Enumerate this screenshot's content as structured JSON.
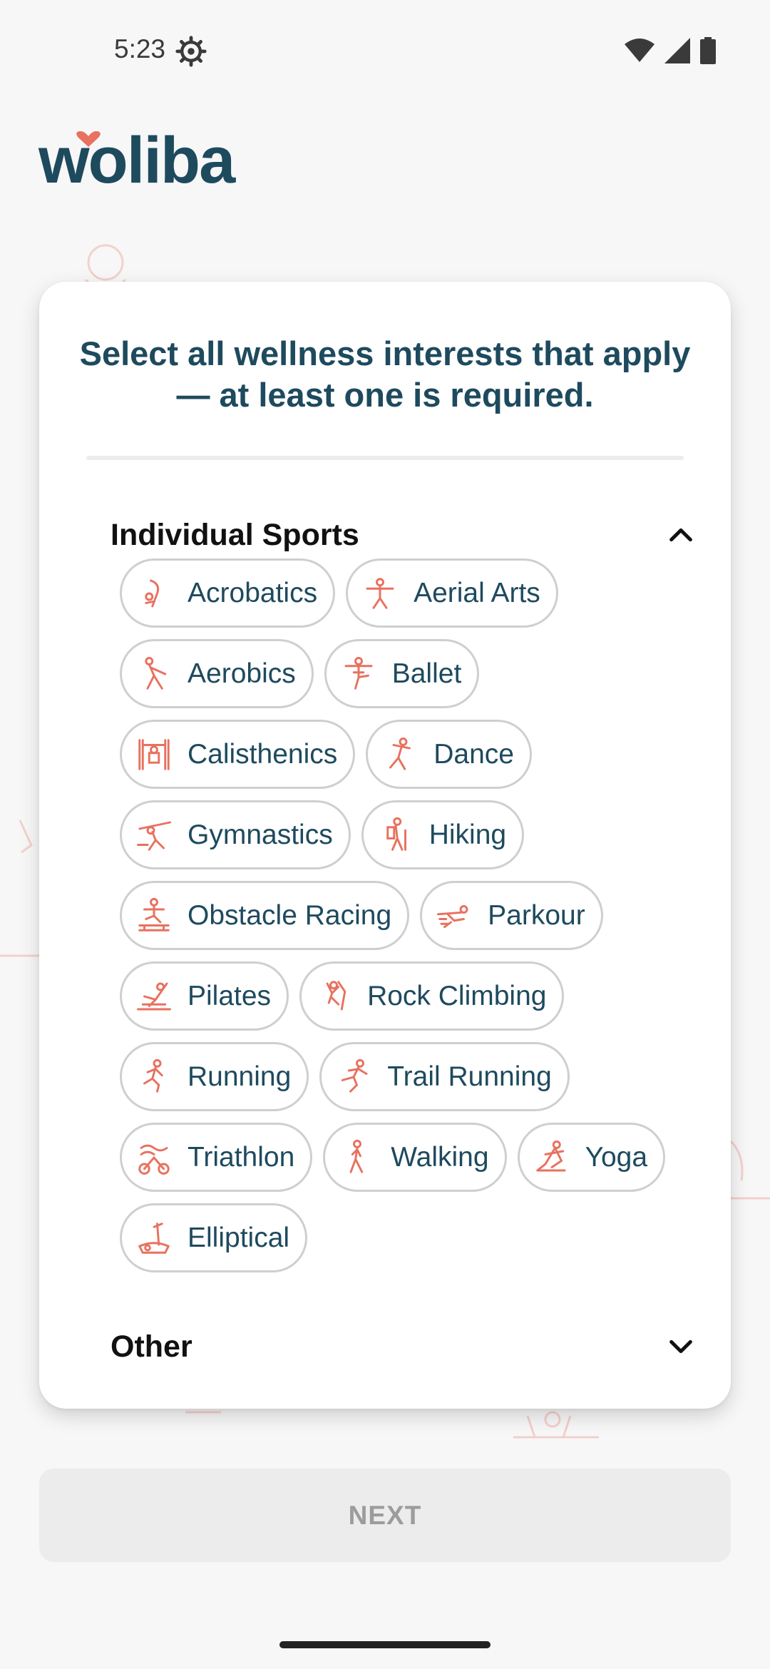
{
  "status_bar": {
    "time": "5:23",
    "icons": [
      "settings-gear-icon",
      "wifi-icon",
      "cellular-signal-icon",
      "battery-icon"
    ]
  },
  "brand": {
    "logo_text": "woliba",
    "color_primary": "#1e4a5e",
    "color_accent": "#e8715f"
  },
  "card": {
    "title": "Select all wellness interests that apply — at least one is required."
  },
  "sections": [
    {
      "title": "Individual Sports",
      "expanded": true,
      "chips": [
        {
          "label": "Acrobatics",
          "icon": "acrobatics-icon"
        },
        {
          "label": "Aerial Arts",
          "icon": "aerial-arts-icon"
        },
        {
          "label": "Aerobics",
          "icon": "aerobics-icon"
        },
        {
          "label": "Ballet",
          "icon": "ballet-icon"
        },
        {
          "label": "Calisthenics",
          "icon": "calisthenics-icon"
        },
        {
          "label": "Dance",
          "icon": "dance-icon"
        },
        {
          "label": "Gymnastics",
          "icon": "gymnastics-icon"
        },
        {
          "label": "Hiking",
          "icon": "hiking-icon"
        },
        {
          "label": "Obstacle Racing",
          "icon": "obstacle-racing-icon"
        },
        {
          "label": "Parkour",
          "icon": "parkour-icon"
        },
        {
          "label": "Pilates",
          "icon": "pilates-icon"
        },
        {
          "label": "Rock Climbing",
          "icon": "rock-climbing-icon"
        },
        {
          "label": "Running",
          "icon": "running-icon"
        },
        {
          "label": "Trail Running",
          "icon": "trail-running-icon"
        },
        {
          "label": "Triathlon",
          "icon": "triathlon-icon"
        },
        {
          "label": "Walking",
          "icon": "walking-icon"
        },
        {
          "label": "Yoga",
          "icon": "yoga-icon"
        },
        {
          "label": "Elliptical",
          "icon": "elliptical-icon"
        }
      ]
    },
    {
      "title": "Other",
      "expanded": false
    }
  ],
  "footer": {
    "next_label": "NEXT",
    "next_enabled": false
  }
}
